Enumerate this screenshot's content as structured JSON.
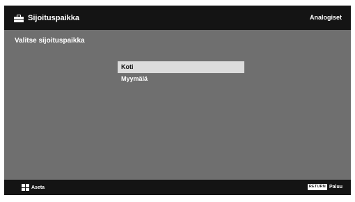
{
  "header": {
    "title": "Sijoituspaikka",
    "title_icon": "briefcase-icon",
    "input_mode": "Analogiset"
  },
  "main": {
    "prompt": "Valitse sijoituspaikka",
    "options": [
      {
        "label": "Koti",
        "selected": true
      },
      {
        "label": "Myymälä",
        "selected": false
      }
    ]
  },
  "footer": {
    "set_icon": "dpad-icon",
    "set_label": "Aseta",
    "return_key": "RETURN",
    "back_label": "Paluu"
  },
  "colors": {
    "background": "#6f6f6f",
    "bars": "#141414",
    "selection": "#dcdcdc"
  }
}
